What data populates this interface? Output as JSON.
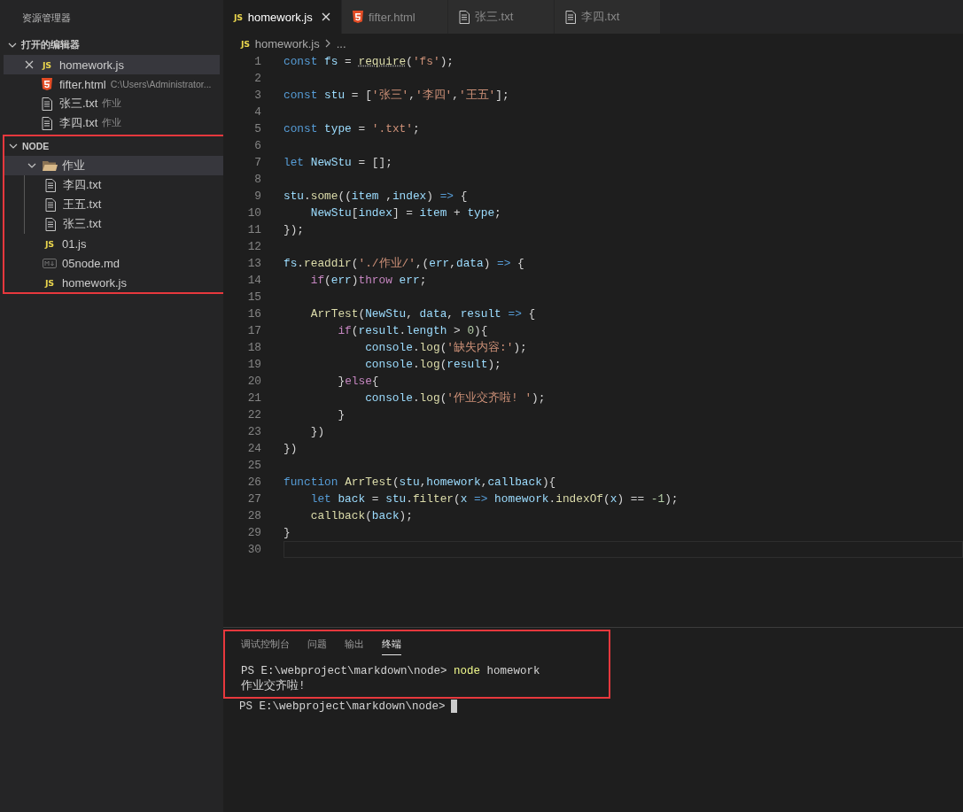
{
  "sidebar": {
    "title": "资源管理器",
    "sections": [
      {
        "label": "打开的编辑器",
        "expanded": true,
        "highlighted": false,
        "items": [
          {
            "name": "homework.js",
            "icon": {
              "kind": "js",
              "text": "JS"
            },
            "closable": true,
            "selected": true
          },
          {
            "name": "fifter.html",
            "icon": {
              "kind": "html"
            },
            "detail": "C:\\Users\\Administrator...",
            "closable": false,
            "selected": false
          },
          {
            "name": "张三.txt",
            "icon": {
              "kind": "txt"
            },
            "detail": "作业",
            "closable": false,
            "selected": false
          },
          {
            "name": "李四.txt",
            "icon": {
              "kind": "txt"
            },
            "detail": "作业",
            "closable": false,
            "selected": false
          }
        ]
      },
      {
        "label": "NODE",
        "expanded": true,
        "highlighted": true,
        "items": [
          {
            "name": "作业",
            "icon": {
              "kind": "folder"
            },
            "expanded": true,
            "selected": true,
            "children": [
              {
                "name": "李四.txt",
                "icon": {
                  "kind": "txt"
                },
                "selected": false
              },
              {
                "name": "王五.txt",
                "icon": {
                  "kind": "txt"
                },
                "selected": false
              },
              {
                "name": "张三.txt",
                "icon": {
                  "kind": "txt"
                },
                "selected": false
              }
            ]
          },
          {
            "name": "01.js",
            "icon": {
              "kind": "js",
              "text": "JS"
            },
            "selected": false
          },
          {
            "name": "05node.md",
            "icon": {
              "kind": "md"
            },
            "selected": false
          },
          {
            "name": "homework.js",
            "icon": {
              "kind": "js",
              "text": "JS"
            },
            "selected": false
          }
        ]
      }
    ]
  },
  "tabs": [
    {
      "label": "homework.js",
      "icon": {
        "kind": "js",
        "text": "JS"
      },
      "selected": true,
      "closable": true
    },
    {
      "label": "fifter.html",
      "icon": {
        "kind": "html"
      },
      "selected": false,
      "closable": false
    },
    {
      "label": "张三.txt",
      "icon": {
        "kind": "txt"
      },
      "selected": false,
      "closable": false
    },
    {
      "label": "李四.txt",
      "icon": {
        "kind": "txt"
      },
      "selected": false,
      "closable": false
    }
  ],
  "breadcrumb": {
    "icon": {
      "kind": "js",
      "text": "JS"
    },
    "file": "homework.js",
    "rest": "..."
  },
  "code": [
    {
      "number": "1",
      "current": false,
      "tokens": [
        {
          "kind": "keyword",
          "text": "const "
        },
        {
          "kind": "variable",
          "text": "fs"
        },
        {
          "kind": "plain",
          "text": " = "
        },
        {
          "kind": "hint",
          "text": "require"
        },
        {
          "kind": "plain",
          "text": "("
        },
        {
          "kind": "string",
          "text": "'fs'"
        },
        {
          "kind": "plain",
          "text": ");"
        }
      ]
    },
    {
      "number": "2",
      "current": false
    },
    {
      "number": "3",
      "current": false,
      "tokens": [
        {
          "kind": "keyword",
          "text": "const "
        },
        {
          "kind": "variable",
          "text": "stu"
        },
        {
          "kind": "plain",
          "text": " = ["
        },
        {
          "kind": "string",
          "text": "'张三'"
        },
        {
          "kind": "plain",
          "text": ","
        },
        {
          "kind": "string",
          "text": "'李四'"
        },
        {
          "kind": "plain",
          "text": ","
        },
        {
          "kind": "string",
          "text": "'王五'"
        },
        {
          "kind": "plain",
          "text": "];"
        }
      ]
    },
    {
      "number": "4",
      "current": false
    },
    {
      "number": "5",
      "current": false,
      "tokens": [
        {
          "kind": "keyword",
          "text": "const "
        },
        {
          "kind": "variable",
          "text": "type"
        },
        {
          "kind": "plain",
          "text": " = "
        },
        {
          "kind": "string",
          "text": "'.txt'"
        },
        {
          "kind": "plain",
          "text": ";"
        }
      ]
    },
    {
      "number": "6",
      "current": false
    },
    {
      "number": "7",
      "current": false,
      "tokens": [
        {
          "kind": "keyword",
          "text": "let "
        },
        {
          "kind": "variable",
          "text": "NewStu"
        },
        {
          "kind": "plain",
          "text": " = [];"
        }
      ]
    },
    {
      "number": "8",
      "current": false
    },
    {
      "number": "9",
      "current": false,
      "tokens": [
        {
          "kind": "variable",
          "text": "stu"
        },
        {
          "kind": "plain",
          "text": "."
        },
        {
          "kind": "function",
          "text": "some"
        },
        {
          "kind": "plain",
          "text": "(("
        },
        {
          "kind": "variable",
          "text": "item"
        },
        {
          "kind": "plain",
          "text": " ,"
        },
        {
          "kind": "variable",
          "text": "index"
        },
        {
          "kind": "plain",
          "text": ") "
        },
        {
          "kind": "keyword",
          "text": "=>"
        },
        {
          "kind": "plain",
          "text": " {"
        }
      ]
    },
    {
      "number": "10",
      "current": false,
      "tokens": [
        {
          "kind": "variable",
          "text": "    NewStu"
        },
        {
          "kind": "plain",
          "text": "["
        },
        {
          "kind": "variable",
          "text": "index"
        },
        {
          "kind": "plain",
          "text": "] = "
        },
        {
          "kind": "variable",
          "text": "item"
        },
        {
          "kind": "plain",
          "text": " + "
        },
        {
          "kind": "variable",
          "text": "type"
        },
        {
          "kind": "plain",
          "text": ";"
        }
      ]
    },
    {
      "number": "11",
      "current": false,
      "tokens": [
        {
          "kind": "plain",
          "text": "});"
        }
      ]
    },
    {
      "number": "12",
      "current": false
    },
    {
      "number": "13",
      "current": false,
      "tokens": [
        {
          "kind": "variable",
          "text": "fs"
        },
        {
          "kind": "plain",
          "text": "."
        },
        {
          "kind": "function",
          "text": "readdir"
        },
        {
          "kind": "plain",
          "text": "("
        },
        {
          "kind": "string",
          "text": "'./作业/'"
        },
        {
          "kind": "plain",
          "text": ",("
        },
        {
          "kind": "variable",
          "text": "err"
        },
        {
          "kind": "plain",
          "text": ","
        },
        {
          "kind": "variable",
          "text": "data"
        },
        {
          "kind": "plain",
          "text": ") "
        },
        {
          "kind": "keyword",
          "text": "=>"
        },
        {
          "kind": "plain",
          "text": " {"
        }
      ]
    },
    {
      "number": "14",
      "current": false,
      "tokens": [
        {
          "kind": "control",
          "text": "    if"
        },
        {
          "kind": "plain",
          "text": "("
        },
        {
          "kind": "variable",
          "text": "err"
        },
        {
          "kind": "plain",
          "text": ")"
        },
        {
          "kind": "control",
          "text": "throw "
        },
        {
          "kind": "variable",
          "text": "err"
        },
        {
          "kind": "plain",
          "text": ";"
        }
      ]
    },
    {
      "number": "15",
      "current": false
    },
    {
      "number": "16",
      "current": false,
      "tokens": [
        {
          "kind": "function",
          "text": "    ArrTest"
        },
        {
          "kind": "plain",
          "text": "("
        },
        {
          "kind": "variable",
          "text": "NewStu"
        },
        {
          "kind": "plain",
          "text": ", "
        },
        {
          "kind": "variable",
          "text": "data"
        },
        {
          "kind": "plain",
          "text": ", "
        },
        {
          "kind": "variable",
          "text": "result "
        },
        {
          "kind": "keyword",
          "text": "=>"
        },
        {
          "kind": "plain",
          "text": " {"
        }
      ]
    },
    {
      "number": "17",
      "current": false,
      "tokens": [
        {
          "kind": "control",
          "text": "        if"
        },
        {
          "kind": "plain",
          "text": "("
        },
        {
          "kind": "variable",
          "text": "result"
        },
        {
          "kind": "plain",
          "text": "."
        },
        {
          "kind": "variable",
          "text": "length"
        },
        {
          "kind": "plain",
          "text": " > "
        },
        {
          "kind": "number",
          "text": "0"
        },
        {
          "kind": "plain",
          "text": "){"
        }
      ]
    },
    {
      "number": "18",
      "current": false,
      "tokens": [
        {
          "kind": "variable",
          "text": "            console"
        },
        {
          "kind": "plain",
          "text": "."
        },
        {
          "kind": "function",
          "text": "log"
        },
        {
          "kind": "plain",
          "text": "("
        },
        {
          "kind": "string",
          "text": "'缺失内容:'"
        },
        {
          "kind": "plain",
          "text": ");"
        }
      ]
    },
    {
      "number": "19",
      "current": false,
      "tokens": [
        {
          "kind": "variable",
          "text": "            console"
        },
        {
          "kind": "plain",
          "text": "."
        },
        {
          "kind": "function",
          "text": "log"
        },
        {
          "kind": "plain",
          "text": "("
        },
        {
          "kind": "variable",
          "text": "result"
        },
        {
          "kind": "plain",
          "text": ");"
        }
      ]
    },
    {
      "number": "20",
      "current": false,
      "tokens": [
        {
          "kind": "plain",
          "text": "        }"
        },
        {
          "kind": "control",
          "text": "else"
        },
        {
          "kind": "plain",
          "text": "{"
        }
      ]
    },
    {
      "number": "21",
      "current": false,
      "tokens": [
        {
          "kind": "variable",
          "text": "            console"
        },
        {
          "kind": "plain",
          "text": "."
        },
        {
          "kind": "function",
          "text": "log"
        },
        {
          "kind": "plain",
          "text": "("
        },
        {
          "kind": "string",
          "text": "'作业交齐啦! '"
        },
        {
          "kind": "plain",
          "text": ");"
        }
      ]
    },
    {
      "number": "22",
      "current": false,
      "tokens": [
        {
          "kind": "plain",
          "text": "        }"
        }
      ]
    },
    {
      "number": "23",
      "current": false,
      "tokens": [
        {
          "kind": "plain",
          "text": "    })"
        }
      ]
    },
    {
      "number": "24",
      "current": false,
      "tokens": [
        {
          "kind": "plain",
          "text": "})"
        }
      ]
    },
    {
      "number": "25",
      "current": false
    },
    {
      "number": "26",
      "current": false,
      "tokens": [
        {
          "kind": "keyword",
          "text": "function "
        },
        {
          "kind": "function",
          "text": "ArrTest"
        },
        {
          "kind": "plain",
          "text": "("
        },
        {
          "kind": "variable",
          "text": "stu"
        },
        {
          "kind": "plain",
          "text": ","
        },
        {
          "kind": "variable",
          "text": "homework"
        },
        {
          "kind": "plain",
          "text": ","
        },
        {
          "kind": "variable",
          "text": "callback"
        },
        {
          "kind": "plain",
          "text": "){"
        }
      ]
    },
    {
      "number": "27",
      "current": false,
      "tokens": [
        {
          "kind": "keyword",
          "text": "    let "
        },
        {
          "kind": "variable",
          "text": "back"
        },
        {
          "kind": "plain",
          "text": " = "
        },
        {
          "kind": "variable",
          "text": "stu"
        },
        {
          "kind": "plain",
          "text": "."
        },
        {
          "kind": "function",
          "text": "filter"
        },
        {
          "kind": "plain",
          "text": "("
        },
        {
          "kind": "variable",
          "text": "x "
        },
        {
          "kind": "keyword",
          "text": "=> "
        },
        {
          "kind": "variable",
          "text": "homework"
        },
        {
          "kind": "plain",
          "text": "."
        },
        {
          "kind": "function",
          "text": "indexOf"
        },
        {
          "kind": "plain",
          "text": "("
        },
        {
          "kind": "variable",
          "text": "x"
        },
        {
          "kind": "plain",
          "text": ") == "
        },
        {
          "kind": "number",
          "text": "-1"
        },
        {
          "kind": "plain",
          "text": ");"
        }
      ]
    },
    {
      "number": "28",
      "current": false,
      "tokens": [
        {
          "kind": "function",
          "text": "    callback"
        },
        {
          "kind": "plain",
          "text": "("
        },
        {
          "kind": "variable",
          "text": "back"
        },
        {
          "kind": "plain",
          "text": ");"
        }
      ]
    },
    {
      "number": "29",
      "current": false,
      "tokens": [
        {
          "kind": "plain",
          "text": "}"
        }
      ]
    },
    {
      "number": "30",
      "current": true
    }
  ],
  "panel": {
    "tabs": [
      {
        "label": "调试控制台",
        "selected": false
      },
      {
        "label": "问题",
        "selected": false
      },
      {
        "label": "输出",
        "selected": false
      },
      {
        "label": "终端",
        "selected": true
      }
    ],
    "terminal": [
      {
        "highlighted": true,
        "cursor": false,
        "tokens": [
          {
            "kind": "plain",
            "text": "PS E:\\webproject\\markdown\\node> "
          },
          {
            "kind": "command",
            "text": "node"
          },
          {
            "kind": "plain",
            "text": " homework"
          }
        ]
      },
      {
        "highlighted": true,
        "cursor": false,
        "tokens": [
          {
            "kind": "plain",
            "text": "作业交齐啦!"
          }
        ]
      },
      {
        "highlighted": false,
        "cursor": true,
        "tokens": [
          {
            "kind": "plain",
            "text": "PS E:\\webproject\\markdown\\node>"
          }
        ]
      }
    ]
  }
}
